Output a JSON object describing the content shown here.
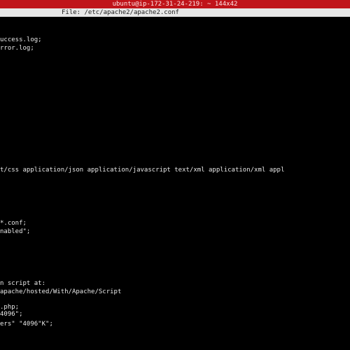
{
  "window": {
    "title": "ubuntu@ip-172-31-24-219: ~ 144x42"
  },
  "nano": {
    "file_label": "File: /etc/apache2/apache2.conf"
  },
  "editor": {
    "lines": [
      "uccess.log;",
      "rror.log;",
      "t/css application/json application/javascript text/xml application/xml appl",
      "*.conf;",
      "nabled\";",
      "n script at:",
      "apache/hosted/With/Apache/Script",
      ".php;",
      "4096\";",
      "ers\" \"4096\"K\";"
    ]
  },
  "colors": {
    "titlebar_bg": "#c0141a",
    "terminal_bg": "#000000",
    "terminal_fg": "#e8e8e8",
    "header_bg": "#e7e7e7"
  }
}
